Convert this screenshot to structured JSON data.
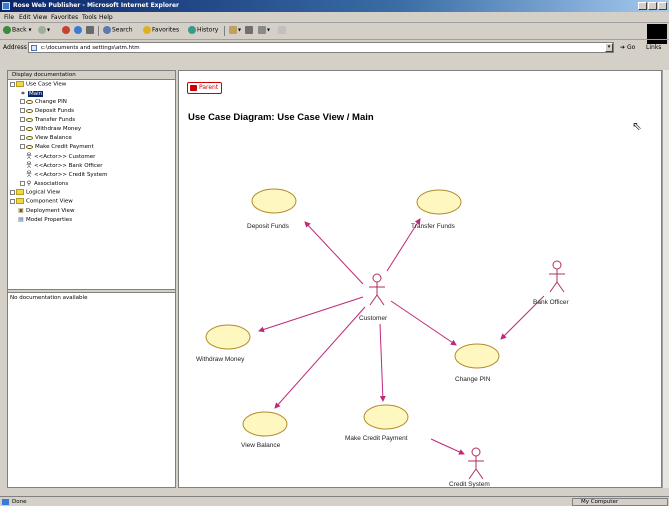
{
  "window": {
    "title": "Rose Web Publisher - Microsoft Internet Explorer"
  },
  "menu": {
    "items": [
      "File",
      "Edit",
      "View",
      "Favorites",
      "Tools",
      "Help"
    ]
  },
  "toolbar": {
    "back": "Back",
    "search": "Search",
    "favorites": "Favorites",
    "history": "History"
  },
  "address": {
    "label": "Address",
    "value": "c:\\documents and settings\\atm.htm",
    "go": "Go",
    "links": "Links"
  },
  "left_pane": {
    "header": "Display documentation",
    "tree": [
      {
        "label": "Use Case View",
        "level": 0,
        "kind": "folder"
      },
      {
        "label": "Main",
        "level": 1,
        "kind": "diagram",
        "selected": true
      },
      {
        "label": "Change PIN",
        "level": 1,
        "kind": "usecase"
      },
      {
        "label": "Deposit Funds",
        "level": 1,
        "kind": "usecase"
      },
      {
        "label": "Transfer Funds",
        "level": 1,
        "kind": "usecase"
      },
      {
        "label": "Withdraw Money",
        "level": 1,
        "kind": "usecase"
      },
      {
        "label": "View Balance",
        "level": 1,
        "kind": "usecase"
      },
      {
        "label": "Make Credit Payment",
        "level": 1,
        "kind": "usecase"
      },
      {
        "label": "<<Actor>> Customer",
        "level": 1,
        "kind": "actor"
      },
      {
        "label": "<<Actor>> Bank Officer",
        "level": 1,
        "kind": "actor"
      },
      {
        "label": "<<Actor>> Credit System",
        "level": 1,
        "kind": "actor"
      },
      {
        "label": "Associations",
        "level": 1,
        "kind": "assoc"
      },
      {
        "label": "Logical View",
        "level": 0,
        "kind": "folder"
      },
      {
        "label": "Component View",
        "level": 0,
        "kind": "folder"
      },
      {
        "label": "Deployment View",
        "level": 0,
        "kind": "deploy"
      },
      {
        "label": "Model Properties",
        "level": 0,
        "kind": "props"
      }
    ],
    "doc_text": "No documentation available"
  },
  "content": {
    "parent_button": "Parent",
    "diagram_title": "Use Case Diagram: Use Case View / Main",
    "use_cases": [
      "Deposit Funds",
      "Transfer Funds",
      "Withdraw Money",
      "Change PIN",
      "View Balance",
      "Make Credit Payment"
    ],
    "actors": [
      "Customer",
      "Bank Officer",
      "Credit System"
    ]
  },
  "status": {
    "text": "Done",
    "zone": "My Computer"
  },
  "colors": {
    "usecase_fill": "#fff7c0",
    "usecase_stroke": "#b08a2a",
    "assoc": "#c0287a",
    "actor": "#b0305a"
  }
}
